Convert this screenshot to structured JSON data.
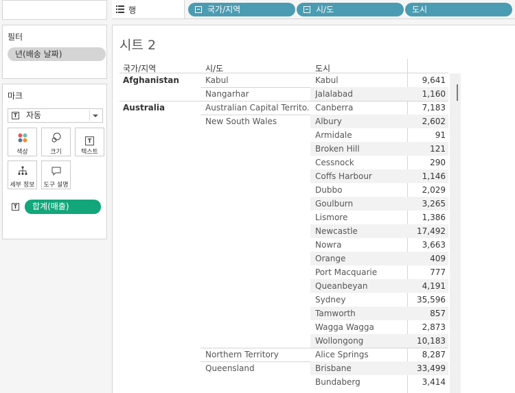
{
  "filters": {
    "title": "필터",
    "items": [
      {
        "label": "년(배송 날짜)"
      }
    ]
  },
  "marks": {
    "title": "마크",
    "type_label": "자동",
    "buttons": [
      {
        "label": "색상",
        "icon": "color-dots-icon"
      },
      {
        "label": "크기",
        "icon": "size-circles-icon"
      },
      {
        "label": "텍스트",
        "icon": "text-box-icon"
      },
      {
        "label": "세부 정보",
        "icon": "detail-tree-icon"
      },
      {
        "label": "도구 설명",
        "icon": "speech-bubble-icon"
      }
    ],
    "measure_pill": "합계(매출)"
  },
  "shelf": {
    "rows_label": "행",
    "pills": [
      {
        "label": "국가/지역"
      },
      {
        "label": "시/도"
      },
      {
        "label": "도시"
      }
    ]
  },
  "sheet": {
    "title": "시트 2",
    "headers": {
      "country": "국가/지역",
      "region": "시/도",
      "city": "도시"
    },
    "rows": [
      {
        "country": "Afghanistan",
        "region": "Kabul",
        "city": "Kabul",
        "value": "9,641"
      },
      {
        "country": "",
        "region": "Nangarhar",
        "city": "Jalalabad",
        "value": "1,160"
      },
      {
        "country": "Australia",
        "region": "Australian Capital Territo..",
        "city": "Canberra",
        "value": "7,183"
      },
      {
        "country": "",
        "region": "New South Wales",
        "city": "Albury",
        "value": "2,602"
      },
      {
        "country": "",
        "region": "",
        "city": "Armidale",
        "value": "91"
      },
      {
        "country": "",
        "region": "",
        "city": "Broken Hill",
        "value": "121"
      },
      {
        "country": "",
        "region": "",
        "city": "Cessnock",
        "value": "290"
      },
      {
        "country": "",
        "region": "",
        "city": "Coffs Harbour",
        "value": "1,146"
      },
      {
        "country": "",
        "region": "",
        "city": "Dubbo",
        "value": "2,029"
      },
      {
        "country": "",
        "region": "",
        "city": "Goulburn",
        "value": "3,265"
      },
      {
        "country": "",
        "region": "",
        "city": "Lismore",
        "value": "1,386"
      },
      {
        "country": "",
        "region": "",
        "city": "Newcastle",
        "value": "17,492"
      },
      {
        "country": "",
        "region": "",
        "city": "Nowra",
        "value": "3,663"
      },
      {
        "country": "",
        "region": "",
        "city": "Orange",
        "value": "409"
      },
      {
        "country": "",
        "region": "",
        "city": "Port Macquarie",
        "value": "777"
      },
      {
        "country": "",
        "region": "",
        "city": "Queanbeyan",
        "value": "4,191"
      },
      {
        "country": "",
        "region": "",
        "city": "Sydney",
        "value": "35,596"
      },
      {
        "country": "",
        "region": "",
        "city": "Tamworth",
        "value": "857"
      },
      {
        "country": "",
        "region": "",
        "city": "Wagga Wagga",
        "value": "2,873"
      },
      {
        "country": "",
        "region": "",
        "city": "Wollongong",
        "value": "10,183"
      },
      {
        "country": "",
        "region": "Northern Territory",
        "city": "Alice Springs",
        "value": "8,287"
      },
      {
        "country": "",
        "region": "Queensland",
        "city": "Brisbane",
        "value": "33,499"
      },
      {
        "country": "",
        "region": "",
        "city": "Bundaberg",
        "value": "3,414"
      }
    ]
  },
  "colors": {
    "dimension_pill": "#4b9cb2",
    "measure_pill": "#13a67b",
    "filter_pill": "#d4d4d4"
  }
}
